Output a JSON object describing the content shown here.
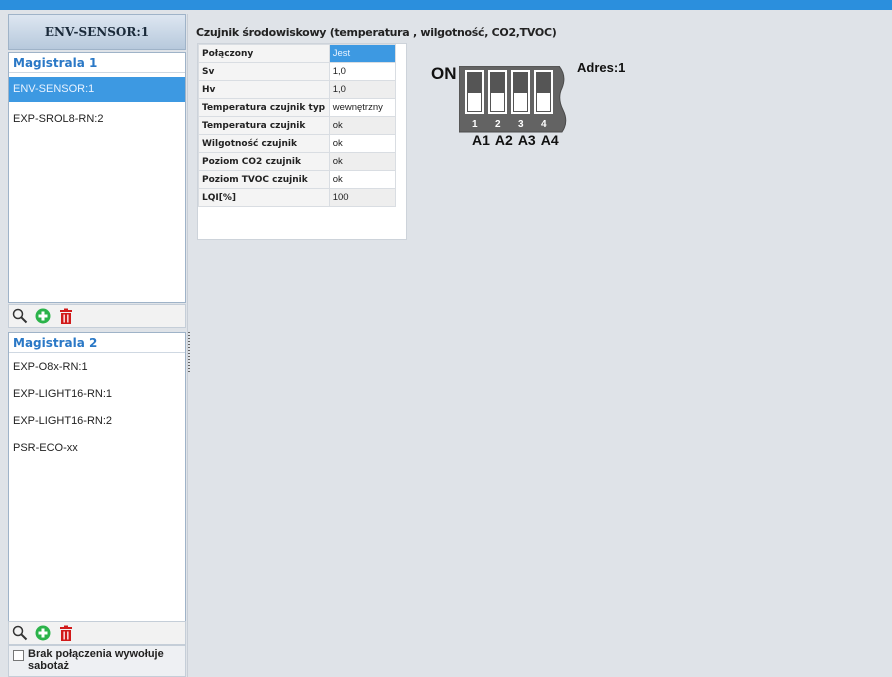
{
  "left": {
    "header": "ENV-SENSOR:1",
    "bus1": {
      "title": "Magistrala 1",
      "items": [
        {
          "label": "ENV-SENSOR:1",
          "selected": true
        },
        {
          "label": "EXP-SROL8-RN:2",
          "selected": false
        }
      ]
    },
    "bus2": {
      "title": "Magistrala 2",
      "items": [
        {
          "label": "EXP-O8x-RN:1"
        },
        {
          "label": "EXP-LIGHT16-RN:1"
        },
        {
          "label": "EXP-LIGHT16-RN:2"
        },
        {
          "label": "PSR-ECO-xx"
        }
      ]
    },
    "toolbar_icons": [
      "search-icon",
      "add-icon",
      "delete-icon"
    ],
    "sabotage_label": "Brak połączenia wywołuje sabotaż",
    "sabotage_checked": false
  },
  "main": {
    "title": "Czujnik środowiskowy (temperatura , wilgotność, CO2,TVOC)",
    "properties": [
      {
        "key": "Połączony",
        "value": "Jest"
      },
      {
        "key": "Sv",
        "value": "1,0"
      },
      {
        "key": "Hv",
        "value": "1,0"
      },
      {
        "key": "Temperatura czujnik typ",
        "value": "wewnętrzny"
      },
      {
        "key": "Temperatura czujnik",
        "value": "ok"
      },
      {
        "key": "Wilgotność czujnik",
        "value": "ok"
      },
      {
        "key": "Poziom CO2 czujnik",
        "value": "ok"
      },
      {
        "key": "Poziom TVOC czujnik",
        "value": "ok"
      },
      {
        "key": "LQI[%]",
        "value": "100"
      }
    ],
    "dip": {
      "on_label": "ON",
      "address_label": "Adres:1",
      "switch_numbers": [
        "1",
        "2",
        "3",
        "4"
      ],
      "switch_names": [
        "A1",
        "A2",
        "A3",
        "A4"
      ]
    }
  },
  "colors": {
    "accent": "#3d99e2",
    "bus_title": "#2a78c6",
    "add": "#2bb34a",
    "delete": "#d11a1a"
  }
}
